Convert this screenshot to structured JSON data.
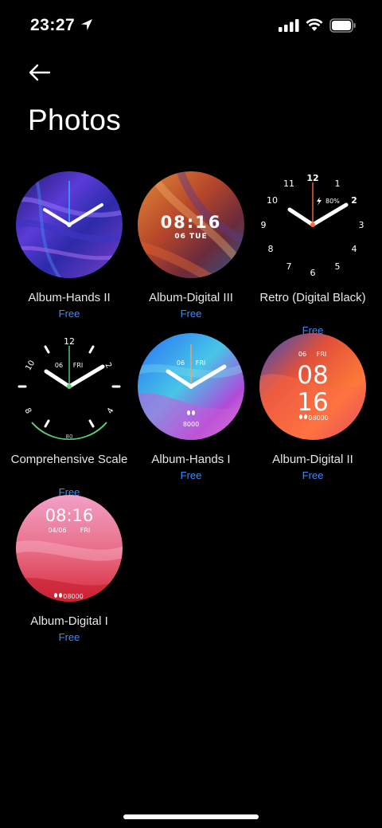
{
  "status_bar": {
    "time": "23:27",
    "icons": [
      "location-arrow-icon",
      "cellular-signal-icon",
      "wifi-icon",
      "battery-icon"
    ]
  },
  "header": {
    "back_icon": "arrow-left-icon",
    "title": "Photos"
  },
  "colors": {
    "background": "#000000",
    "price": "#3d8bff",
    "label": "#e6e6e6"
  },
  "faces": [
    {
      "name": "Album-Hands II",
      "price": "Free"
    },
    {
      "name": "Album-Digital III",
      "price": "Free",
      "time": "08:16",
      "date": "06 TUE"
    },
    {
      "name": "Retro (Digital Black)",
      "price": "Free",
      "battery": "80%",
      "numerals": [
        "12",
        "1",
        "2",
        "3",
        "4",
        "5",
        "6",
        "7",
        "8",
        "9",
        "10",
        "11"
      ]
    },
    {
      "name": "Comprehensive Scale",
      "price": "Free",
      "date_day": "06",
      "date_weekday": "FRI",
      "battery": "80",
      "numerals": [
        "12",
        "2",
        "4",
        "8",
        "10"
      ]
    },
    {
      "name": "Album-Hands I",
      "price": "Free",
      "date_day": "06",
      "date_weekday": "FRI",
      "steps": "8000"
    },
    {
      "name": "Album-Digital II",
      "price": "Free",
      "date_day": "06",
      "date_weekday": "FRI",
      "hour": "08",
      "minute": "16",
      "steps": "08000"
    },
    {
      "name": "Album-Digital I",
      "price": "Free",
      "time": "08:16",
      "date": "04/06",
      "weekday": "FRI",
      "steps": "08000"
    }
  ]
}
